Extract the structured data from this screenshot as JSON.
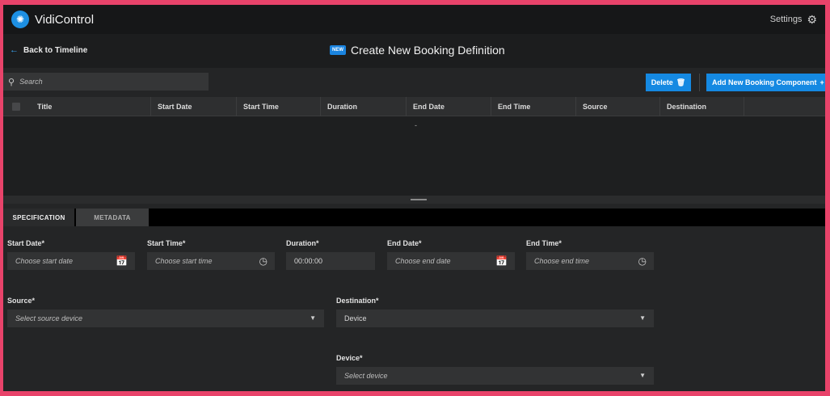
{
  "app": {
    "title": "VidiControl",
    "settings_label": "Settings"
  },
  "header": {
    "back_label": "Back to Timeline",
    "badge": "NEW",
    "page_title": "Create New Booking Definition"
  },
  "toolbar": {
    "search_placeholder": "Search",
    "delete_label": "Delete",
    "add_label": "Add New Booking Component"
  },
  "table": {
    "columns": [
      "Title",
      "Start Date",
      "Start Time",
      "Duration",
      "End Date",
      "End Time",
      "Source",
      "Destination"
    ],
    "empty_marker": "-"
  },
  "tabs": {
    "specification": "SPECIFICATION",
    "metadata": "METADATA"
  },
  "form": {
    "start_date": {
      "label": "Start Date*",
      "placeholder": "Choose start date"
    },
    "start_time": {
      "label": "Start Time*",
      "placeholder": "Choose start time"
    },
    "duration": {
      "label": "Duration*",
      "value": "00:00:00"
    },
    "end_date": {
      "label": "End Date*",
      "placeholder": "Choose end date"
    },
    "end_time": {
      "label": "End Time*",
      "placeholder": "Choose end time"
    },
    "source": {
      "label": "Source*",
      "placeholder": "Select source device"
    },
    "destination": {
      "label": "Destination*",
      "value": "Device"
    },
    "device": {
      "label": "Device*",
      "placeholder": "Select device"
    }
  },
  "colors": {
    "accent": "#1589e2",
    "frame": "#e8436a",
    "background": "#242526"
  },
  "icons": [
    "logo-icon",
    "gear-icon",
    "back-arrow-icon",
    "search-icon",
    "trash-icon",
    "plus-icon",
    "calendar-icon",
    "clock-icon",
    "chevron-down-icon"
  ]
}
